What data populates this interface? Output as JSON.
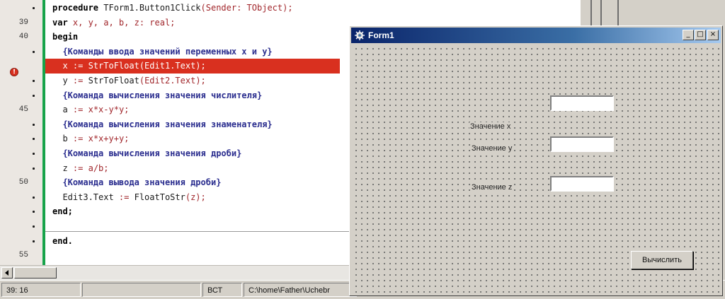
{
  "editor": {
    "line_numbers": [
      {
        "label": "39",
        "row": 1
      },
      {
        "label": "40",
        "row": 2
      },
      {
        "label": "45",
        "row": 7
      },
      {
        "label": "50",
        "row": 12
      },
      {
        "label": "55",
        "row": 17
      }
    ],
    "dot_rows": [
      0,
      3,
      5,
      6,
      8,
      9,
      10,
      11,
      13,
      14,
      15,
      16
    ],
    "breakpoint_row": 4,
    "lines": [
      [
        {
          "t": "procedure ",
          "c": "kw"
        },
        {
          "t": "TForm1.Button1Click",
          "c": "id"
        },
        {
          "t": "(Sender: TObject);",
          "c": "sym"
        }
      ],
      [
        {
          "t": "var ",
          "c": "kw"
        },
        {
          "t": "x, y, a, b, z: real;",
          "c": "sym"
        }
      ],
      [
        {
          "t": "begin",
          "c": "kw"
        }
      ],
      [
        {
          "t": "  {Команды ввода значений переменных x и y}",
          "c": "cm"
        }
      ],
      [
        {
          "t": "  x := StrToFloat(Edit1.Text);",
          "c": "id"
        }
      ],
      [
        {
          "t": "  y ",
          "c": "id"
        },
        {
          "t": ":= ",
          "c": "sym"
        },
        {
          "t": "StrToFloat",
          "c": "id"
        },
        {
          "t": "(Edit2.Text);",
          "c": "sym"
        }
      ],
      [
        {
          "t": "  {Команда вычисления значения числителя}",
          "c": "cm"
        }
      ],
      [
        {
          "t": "  a ",
          "c": "id"
        },
        {
          "t": ":= ",
          "c": "sym"
        },
        {
          "t": "x*x-y*y;",
          "c": "sym"
        }
      ],
      [
        {
          "t": "  {Команда вычисления значения знаменателя}",
          "c": "cm"
        }
      ],
      [
        {
          "t": "  b ",
          "c": "id"
        },
        {
          "t": ":= ",
          "c": "sym"
        },
        {
          "t": "x*x+y+y;",
          "c": "sym"
        }
      ],
      [
        {
          "t": "  {Команда вычисления значения дроби}",
          "c": "cm"
        }
      ],
      [
        {
          "t": "  z ",
          "c": "id"
        },
        {
          "t": ":= ",
          "c": "sym"
        },
        {
          "t": "a/b;",
          "c": "sym"
        }
      ],
      [
        {
          "t": "  {Команда вывода значения дроби}",
          "c": "cm"
        }
      ],
      [
        {
          "t": "  Edit3.Text ",
          "c": "id"
        },
        {
          "t": ":= ",
          "c": "sym"
        },
        {
          "t": "FloatToStr",
          "c": "id"
        },
        {
          "t": "(z);",
          "c": "sym"
        }
      ],
      [
        {
          "t": "end;",
          "c": "kw"
        }
      ],
      [],
      [
        {
          "t": "end.",
          "c": "kw"
        }
      ],
      []
    ]
  },
  "statusbar": {
    "position": "39: 16",
    "mode": "ВСТ",
    "path": "C:\\home\\Father\\Uchebr"
  },
  "form": {
    "title": "Form1",
    "minimize": "_",
    "maximize": "□",
    "close": "×",
    "label_x": "Значение x",
    "label_y": "Значение y",
    "label_z": "Значение z",
    "button": "Вычислить"
  },
  "colors": {
    "breakpoint": "#d9301f",
    "gutter_change_bar": "#17a34a",
    "titlebar": "#0a246a"
  }
}
